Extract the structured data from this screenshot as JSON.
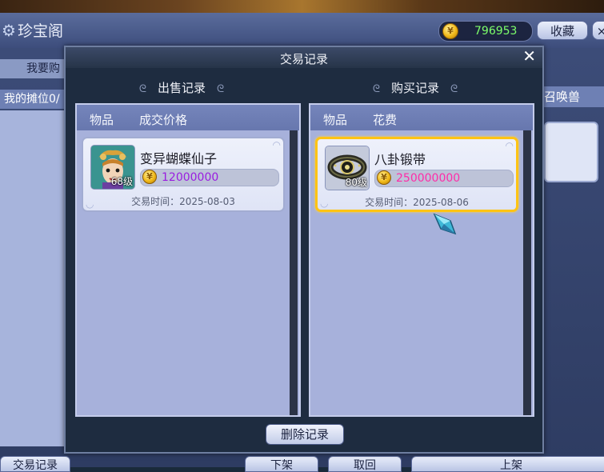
{
  "background": {
    "window_title": "珍宝阁",
    "coins": "796953",
    "favorite_label": "收藏",
    "close_label": "×",
    "tab_left": "我要购",
    "my_stall": "我的摊位0/",
    "summon_tab": "召唤兽",
    "bottom_buttons": [
      "交易记录",
      "下架",
      "取回",
      "上架"
    ]
  },
  "modal": {
    "title": "交易记录",
    "close_label": "✕",
    "sold": {
      "title": "出售记录",
      "col_item": "物品",
      "col_price": "成交价格",
      "records": [
        {
          "name": "变异蝴蝶仙子",
          "level": "68级",
          "price": "12000000",
          "time": "交易时间：2025-08-03",
          "icon": "butterfly-fairy-portrait"
        }
      ]
    },
    "bought": {
      "title": "购买记录",
      "col_item": "物品",
      "col_price": "花费",
      "records": [
        {
          "name": "八卦锻带",
          "level": "80级",
          "price": "250000000",
          "time": "交易时间：2025-08-06",
          "icon": "belt-item",
          "selected": true
        }
      ]
    },
    "delete_label": "删除记录"
  },
  "colors": {
    "coin_green": "#7dff6a",
    "sold_price": "#9a1de0",
    "buy_price": "#ff2ca8",
    "selected_border": "#ffc414"
  }
}
